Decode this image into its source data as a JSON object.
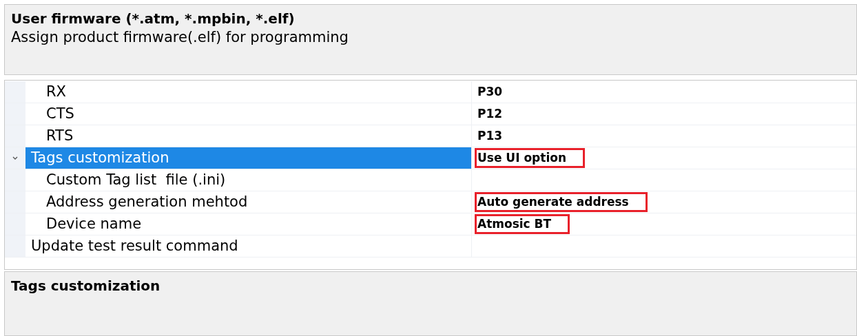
{
  "header": {
    "title": "User firmware (*.atm, *.mpbin, *.elf)",
    "description": "Assign product firmware(.elf) for programming"
  },
  "properties": [
    {
      "children": [
        {
          "label": "RX",
          "value": "P30",
          "selected": false,
          "highlighted": false
        },
        {
          "label": "CTS",
          "value": "P12",
          "selected": false,
          "highlighted": false
        },
        {
          "label": "RTS",
          "value": "P13",
          "selected": false,
          "highlighted": false
        }
      ]
    },
    {
      "label": "Tags customization",
      "value": "Use UI option",
      "selected": true,
      "expanded": true,
      "highlighted": true,
      "children": [
        {
          "label": "Custom Tag list  file (.ini)",
          "selected": false
        },
        {
          "label": "Address generation mehtod",
          "value": "Auto generate address",
          "selected": false,
          "highlighted": true
        },
        {
          "label": "Device name",
          "value": "Atmosic BT",
          "selected": false,
          "highlighted": true
        }
      ]
    },
    {
      "label": "Update test result command",
      "selected": false
    }
  ],
  "help": {
    "title": "Tags customization"
  }
}
